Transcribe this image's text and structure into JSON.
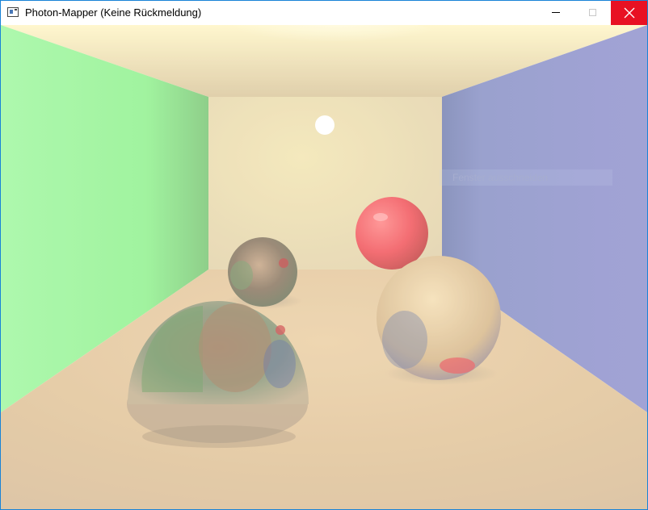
{
  "window": {
    "title": "Photon-Mapper (Keine Rückmeldung)",
    "icon": "app-window-icon",
    "controls": {
      "minimize": "minimize-icon",
      "maximize": "maximize-icon",
      "close": "close-icon",
      "close_hover_color": "#e81123"
    }
  },
  "render": {
    "scene": "cornell-box",
    "left_wall_color": "#9bf59a",
    "right_wall_color": "#8f95cf",
    "back_wall_color": "#ede1b8",
    "floor_color": "#e1c399",
    "light_color": "#ffffff",
    "red_sphere_color": "#f35b62"
  },
  "overlay": {
    "label": "Fenster ausschneiden"
  }
}
